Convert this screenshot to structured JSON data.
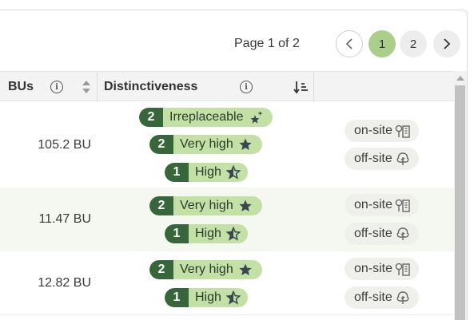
{
  "pagination": {
    "label": "Page 1 of 2",
    "pages": [
      "1",
      "2"
    ],
    "current_page": "1"
  },
  "table": {
    "columns": {
      "bus": "BUs",
      "distinctiveness": "Distinctiveness"
    },
    "rows": [
      {
        "bu": "105.2 BU",
        "badges": [
          {
            "count": "2",
            "label": "Irreplaceable",
            "icon": "sparkle-star-icon"
          },
          {
            "count": "2",
            "label": "Very high",
            "icon": "star-icon"
          },
          {
            "count": "1",
            "label": "High",
            "icon": "half-star-icon"
          }
        ],
        "sites": [
          {
            "label": "on-site",
            "icon": "tree-building-icon"
          },
          {
            "label": "off-site",
            "icon": "tree-icon"
          }
        ]
      },
      {
        "bu": "11.47 BU",
        "badges": [
          {
            "count": "2",
            "label": "Very high",
            "icon": "star-icon"
          },
          {
            "count": "1",
            "label": "High",
            "icon": "half-star-icon"
          }
        ],
        "sites": [
          {
            "label": "on-site",
            "icon": "tree-building-icon"
          },
          {
            "label": "off-site",
            "icon": "tree-icon"
          }
        ]
      },
      {
        "bu": "12.82 BU",
        "badges": [
          {
            "count": "2",
            "label": "Very high",
            "icon": "star-icon"
          },
          {
            "count": "1",
            "label": "High",
            "icon": "half-star-icon"
          }
        ],
        "sites": [
          {
            "label": "on-site",
            "icon": "tree-building-icon"
          },
          {
            "label": "off-site",
            "icon": "tree-icon"
          }
        ]
      }
    ]
  },
  "colors": {
    "badge_dark": "#37663b",
    "badge_light": "#c3e0a5",
    "page_active": "#a9cf8a",
    "row_alt": "#f5f8f1"
  }
}
